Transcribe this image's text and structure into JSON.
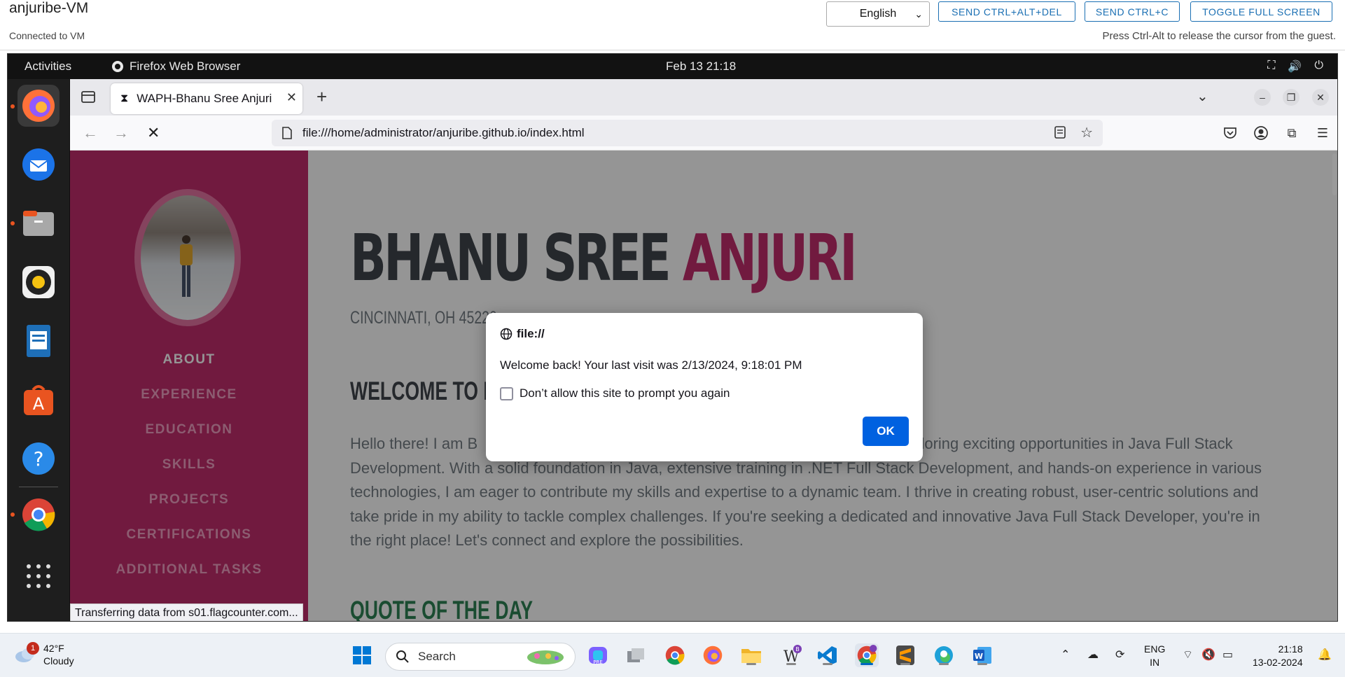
{
  "vm": {
    "title": "anjuribe-VM",
    "status": "Connected to VM",
    "language": "English",
    "buttons": [
      "SEND CTRL+ALT+DEL",
      "SEND CTRL+C",
      "TOGGLE FULL SCREEN"
    ],
    "hint": "Press Ctrl-Alt to release the cursor from the guest."
  },
  "gnome": {
    "activities": "Activities",
    "app_name": "Firefox Web Browser",
    "clock": "Feb 13  21:18"
  },
  "firefox": {
    "tab_title": "WAPH-Bhanu Sree Anjuri",
    "url": "file:///home/administrator/anjuribe.github.io/index.html",
    "status_text": "Transferring data from s01.flagcounter.com..."
  },
  "site": {
    "first_name": "BHANU SREE",
    "last_name": "ANJURI",
    "address": "CINCINNATI, OH 45220",
    "welcome_heading": "WELCOME TO MY",
    "intro": "Hello there! I am B                                                                                          onal exploring exciting opportunities in Java Full Stack Development. With a solid foundation in Java, extensive training in .NET Full Stack Development, and hands-on experience in various technologies, I am eager to contribute my skills and expertise to a dynamic team. I thrive in creating robust, user-centric solutions and take pride in my ability to tackle complex challenges. If you're seeking a dedicated and innovative Java Full Stack Developer, you're in the right place! Let's connect and explore the possibilities.",
    "quote_heading": "QUOTE OF THE DAY",
    "nav": [
      "ABOUT",
      "EXPERIENCE",
      "EDUCATION",
      "SKILLS",
      "PROJECTS",
      "CERTIFICATIONS",
      "ADDITIONAL TASKS"
    ]
  },
  "dialog": {
    "origin": "file://",
    "message": "Welcome back! Your last visit was 2/13/2024, 9:18:01 PM",
    "checkbox_label": "Don’t allow this site to prompt you again",
    "ok_label": "OK"
  },
  "taskbar": {
    "weather_temp": "42°F",
    "weather_condition": "Cloudy",
    "weather_badge": "1",
    "search_placeholder": "Search",
    "lang_top": "ENG",
    "lang_bottom": "IN",
    "time": "21:18",
    "date": "13-02-2024"
  },
  "colors": {
    "sidebar": "#bd1f63",
    "accent_name": "#bd1f63",
    "quote": "#1f7a4a",
    "ok_button": "#0061e0",
    "vm_button": "#1a6fb3"
  }
}
